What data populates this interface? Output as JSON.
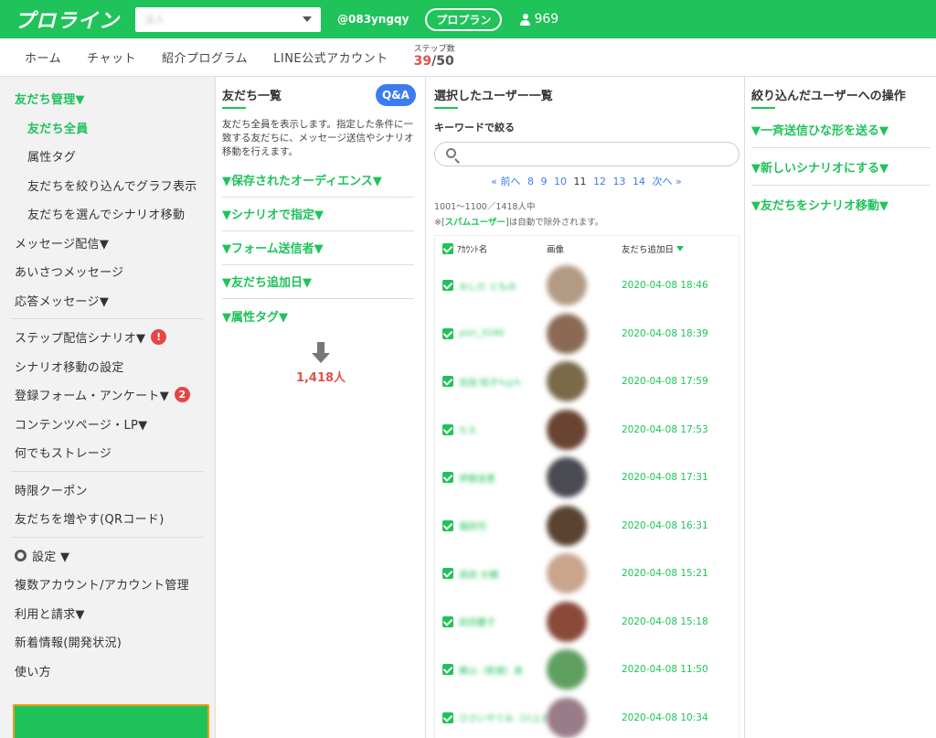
{
  "header": {
    "logo": "プロライン",
    "account_select": "法人",
    "user_id": "@083yngqy",
    "plan_button": "プロプラン",
    "friends_count": "969"
  },
  "nav": {
    "items": [
      "ホーム",
      "チャット",
      "紹介プログラム",
      "LINE公式アカウント"
    ],
    "step_label": "ステップ数",
    "step_current": "39",
    "step_total": "50"
  },
  "sidebar": {
    "friends_head": "友だち管理▼",
    "friends_all": "友だち全員",
    "attr_tag": "属性タグ",
    "filter_graph": "友だちを絞り込んでグラフ表示",
    "select_scenario": "友だちを選んでシナリオ移動",
    "message": "メッセージ配信▼",
    "greeting": "あいさつメッセージ",
    "reply": "応答メッセージ▼",
    "step_scenario": "ステップ配信シナリオ▼",
    "step_badge": "!",
    "scenario_move": "シナリオ移動の設定",
    "form": "登録フォーム・アンケート▼",
    "form_badge": "2",
    "contents": "コンテンツページ・LP▼",
    "storage": "何でもストレージ",
    "coupon": "時限クーポン",
    "qr": "友だちを増やす(QRコード)",
    "settings": "設定 ▼",
    "multi_account": "複数アカウント/アカウント管理",
    "billing": "利用と請求▼",
    "news": "新着情報(開発状況)",
    "howto": "使い方"
  },
  "col2": {
    "title": "友だち一覧",
    "qa": "Q&A",
    "desc": "友だち全員を表示します。指定した条件に一致する友だちに、メッセージ送信やシナリオ移動を行えます。",
    "filters": [
      "▼保存されたオーディエンス▼",
      "▼シナリオで指定▼",
      "▼フォーム送信者▼",
      "▼友だち追加日▼",
      "▼属性タグ▼"
    ],
    "result_count": "1,418人"
  },
  "col3": {
    "title": "選択したユーザー一覧",
    "keyword_label": "キーワードで絞る",
    "search_value": "",
    "pager": {
      "prev": "« 前へ",
      "pages": [
        "8",
        "9",
        "10",
        "11",
        "12",
        "13",
        "14"
      ],
      "current": "11",
      "next": "次へ »"
    },
    "range": "1001〜1100／1418人中",
    "spam_prefix": "※[",
    "spam_word": "スパムユーザー",
    "spam_suffix": "]は自動で除外されます。",
    "col_name": "ｱｶｳﾝﾄ名",
    "col_image": "画像",
    "col_date": "友だち追加日",
    "rows": [
      {
        "name": "みしだ ともみ",
        "date": "2020-04-08 18:46",
        "color": "#b39a84"
      },
      {
        "name": "yuri_3190",
        "date": "2020-04-08 18:39",
        "color": "#8a6a55"
      },
      {
        "name": "吉田 知子✎◎✎",
        "date": "2020-04-08 17:59",
        "color": "#7b6a4a"
      },
      {
        "name": "たえ",
        "date": "2020-04-08 17:53",
        "color": "#6a4433"
      },
      {
        "name": "伊藤佳恵",
        "date": "2020-04-08 17:31",
        "color": "#4a4a52"
      },
      {
        "name": "福田司",
        "date": "2020-04-08 16:31",
        "color": "#5a4330"
      },
      {
        "name": "高田 大輔",
        "date": "2020-04-08 15:21",
        "color": "#c9a58e"
      },
      {
        "name": "前田慶子",
        "date": "2020-04-08 15:18",
        "color": "#8a4a3a"
      },
      {
        "name": "勝山（新城）美",
        "date": "2020-04-08 11:50",
        "color": "#5fa060"
      },
      {
        "name": "ひさいやてみ（川上ま",
        "date": "2020-04-08 10:34",
        "color": "#9a7c88"
      }
    ]
  },
  "col4": {
    "title": "絞り込んだユーザーへの操作",
    "ops": [
      "▼一斉送信ひな形を送る▼",
      "▼新しいシナリオにする▼",
      "▼友だちをシナリオ移動▼"
    ]
  }
}
